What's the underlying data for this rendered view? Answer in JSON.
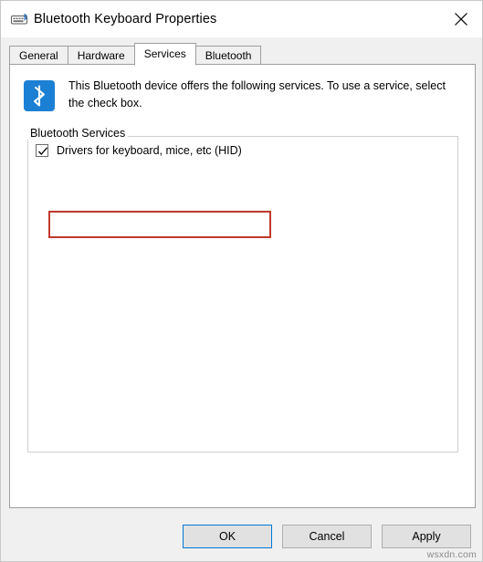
{
  "window": {
    "title": "Bluetooth Keyboard Properties",
    "icon": "bluetooth-keyboard-icon",
    "close_icon": "close-icon"
  },
  "tabs": [
    {
      "label": "General",
      "active": false
    },
    {
      "label": "Hardware",
      "active": false
    },
    {
      "label": "Services",
      "active": true
    },
    {
      "label": "Bluetooth",
      "active": false
    }
  ],
  "content": {
    "icon": "bluetooth-icon",
    "description": "This Bluetooth device offers the following services. To use a service, select the check box.",
    "group_label": "Bluetooth Services",
    "services": [
      {
        "label": "Drivers for keyboard, mice, etc (HID)",
        "checked": true
      }
    ]
  },
  "annotation": {
    "highlight_color": "#c0392b"
  },
  "footer": {
    "buttons": [
      {
        "label": "OK",
        "default": true
      },
      {
        "label": "Cancel",
        "default": false
      },
      {
        "label": "Apply",
        "default": false
      }
    ]
  },
  "watermark": "wsxdn.com"
}
